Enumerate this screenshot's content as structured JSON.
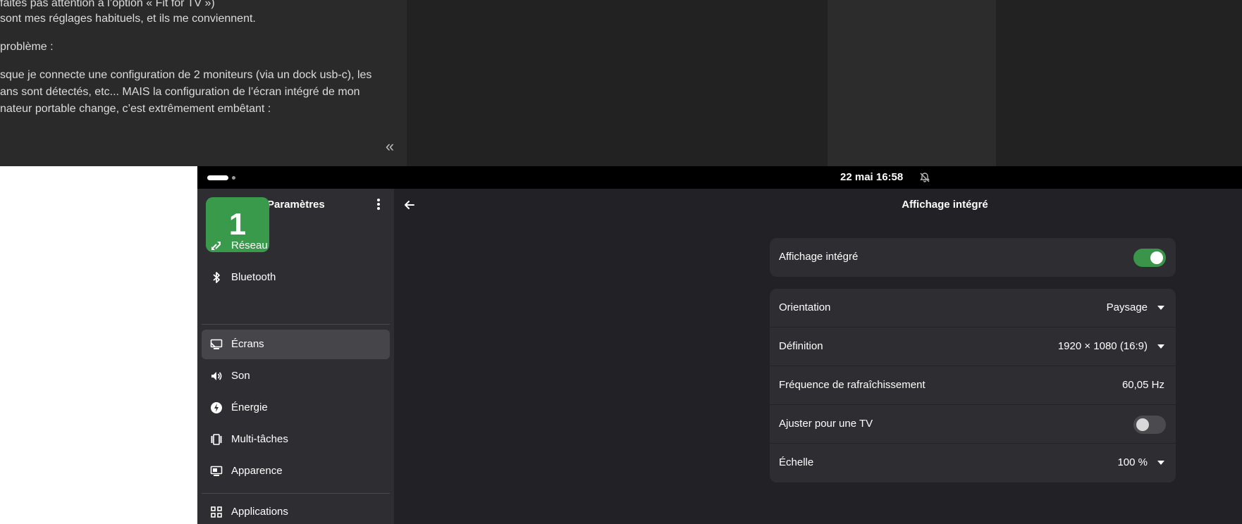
{
  "post": {
    "line1": "faites pas attention à l’option « Fit for TV »)",
    "line2": "sont mes réglages habituels, et ils me conviennent.",
    "line3": "problème :",
    "line4": "sque je connecte une configuration de 2 moniteurs (via un dock usb-c), les",
    "line5": "ans sont détectés, etc... MAIS la configuration de l’écran intégré de mon",
    "line6": "nateur portable change, c’est extrêmement embêtant :",
    "collapse_glyph": "«"
  },
  "topbar": {
    "clock": "22 mai  16:58",
    "notification_icon": "bell-muted-icon"
  },
  "badge": {
    "number": "1",
    "color": "#3a9a4c"
  },
  "sidebar": {
    "title": "Paramètres",
    "menu_icon": "kebab-menu-icon",
    "items": [
      {
        "label": "Réseau",
        "icon": "network-icon"
      },
      {
        "label": "Bluetooth",
        "icon": "bluetooth-icon"
      },
      {
        "label": "Écrans",
        "icon": "display-icon"
      },
      {
        "label": "Son",
        "icon": "speaker-icon"
      },
      {
        "label": "Énergie",
        "icon": "power-icon"
      },
      {
        "label": "Multi-tâches",
        "icon": "multitasking-icon"
      },
      {
        "label": "Apparence",
        "icon": "appearance-icon"
      },
      {
        "label": "Applications",
        "icon": "apps-grid-icon"
      }
    ],
    "active_item": "Écrans"
  },
  "main": {
    "title": "Affichage intégré",
    "back_icon": "back-arrow-icon",
    "enable_row": {
      "label": "Affichage intégré",
      "enabled": true
    },
    "settings": {
      "orientation": {
        "label": "Orientation",
        "value": "Paysage"
      },
      "resolution": {
        "label": "Définition",
        "value": "1920 × 1080 (16:9)"
      },
      "refresh": {
        "label": "Fréquence de rafraîchissement",
        "value": "60,05 Hz"
      },
      "fit_tv": {
        "label": "Ajuster pour une TV",
        "enabled": false
      },
      "scale": {
        "label": "Échelle",
        "value": "100 %"
      }
    }
  },
  "colors": {
    "accent": "#3a944a",
    "sidebar_bg": "#2e2e32",
    "main_bg": "#222226",
    "card_bg": "#2e2e32"
  }
}
